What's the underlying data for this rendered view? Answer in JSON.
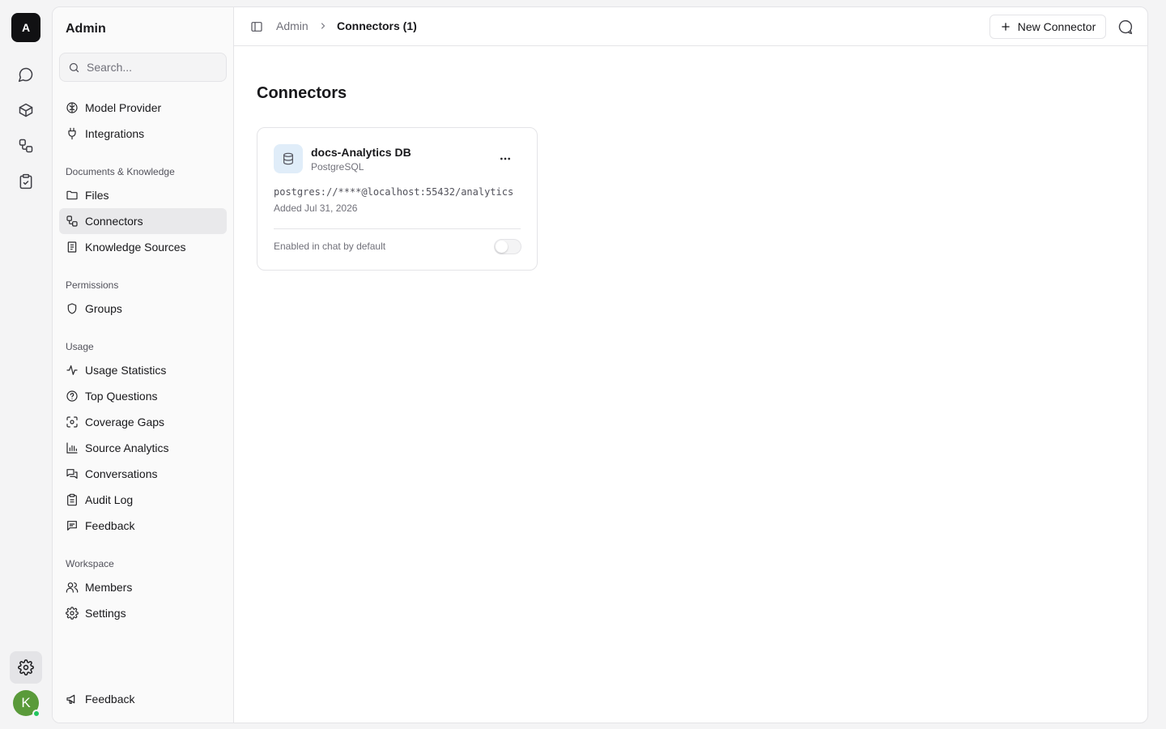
{
  "rail": {
    "logo": "A",
    "avatar": "K"
  },
  "sidebar": {
    "title": "Admin",
    "search_placeholder": "Search...",
    "top_items": [
      {
        "label": "Model Provider"
      },
      {
        "label": "Integrations"
      }
    ],
    "sections": [
      {
        "title": "Documents & Knowledge",
        "items": [
          "Files",
          "Connectors",
          "Knowledge Sources"
        ]
      },
      {
        "title": "Permissions",
        "items": [
          "Groups"
        ]
      },
      {
        "title": "Usage",
        "items": [
          "Usage Statistics",
          "Top Questions",
          "Coverage Gaps",
          "Source Analytics",
          "Conversations",
          "Audit Log",
          "Feedback"
        ]
      },
      {
        "title": "Workspace",
        "items": [
          "Members",
          "Settings"
        ]
      }
    ],
    "active_item": "Connectors",
    "footer_item": "Feedback"
  },
  "topbar": {
    "breadcrumb_root": "Admin",
    "breadcrumb_current": "Connectors (1)",
    "new_button": "New Connector"
  },
  "main": {
    "title": "Connectors",
    "connector": {
      "name": "docs-Analytics DB",
      "type": "PostgreSQL",
      "connection": "postgres://****@localhost:55432/analytics",
      "added": "Added Jul 31, 2026",
      "toggle_label": "Enabled in chat by default",
      "enabled": false
    }
  },
  "colors": {
    "accent": "#111113",
    "active_bg": "#e9e9eb",
    "avatar": "#5a9a3a",
    "online": "#22c55e",
    "db_icon_bg": "#e0edf9"
  }
}
